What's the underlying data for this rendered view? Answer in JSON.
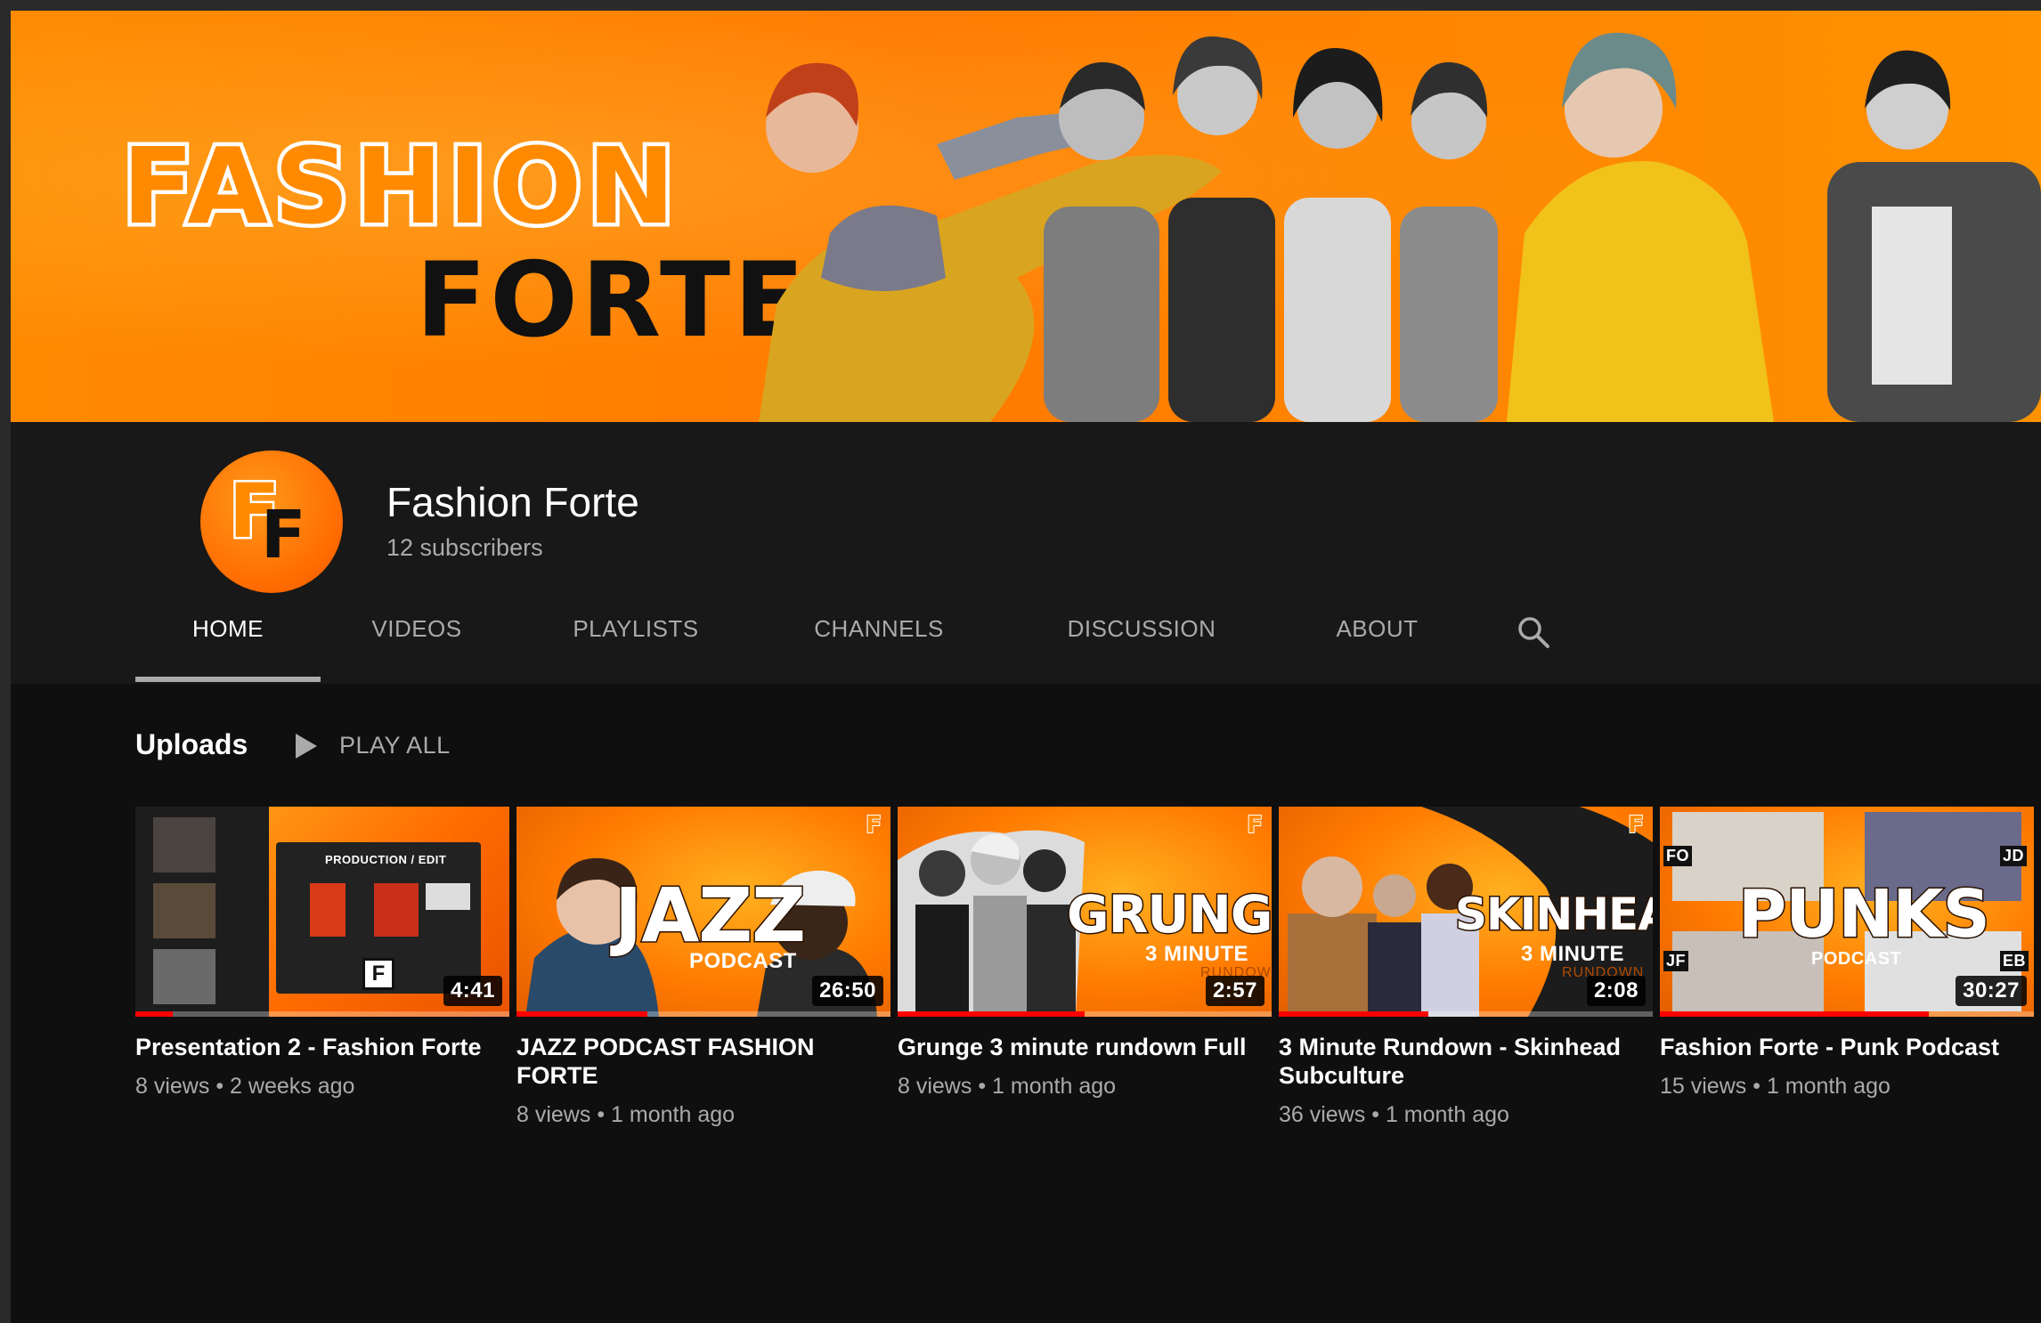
{
  "banner": {
    "line1": "FASHION",
    "line2": "FORTE",
    "background_color": "#ff8000"
  },
  "channel": {
    "avatar_initials_1": "F",
    "avatar_initials_2": "F",
    "name": "Fashion Forte",
    "subscribers": "12 subscribers"
  },
  "tabs": [
    {
      "label": "HOME",
      "active": true
    },
    {
      "label": "VIDEOS",
      "active": false
    },
    {
      "label": "PLAYLISTS",
      "active": false
    },
    {
      "label": "CHANNELS",
      "active": false
    },
    {
      "label": "DISCUSSION",
      "active": false
    },
    {
      "label": "ABOUT",
      "active": false
    }
  ],
  "search_icon": "search-icon",
  "uploads": {
    "title": "Uploads",
    "play_all_label": "PLAY ALL",
    "play_icon": "play-icon"
  },
  "videos": [
    {
      "title": "Presentation 2 - Fashion Forte",
      "views": "8 views",
      "age": "2 weeks ago",
      "duration": "4:41",
      "watched_fraction": 0.1,
      "thumb_text": "PRODUCTION / EDIT",
      "thumb_badge": "F"
    },
    {
      "title": "JAZZ PODCAST FASHION FORTE",
      "views": "8 views",
      "age": "1 month ago",
      "duration": "26:50",
      "watched_fraction": 0.35,
      "thumb_text": "JAZZ",
      "thumb_sub": "PODCAST"
    },
    {
      "title": "Grunge 3 minute rundown Full",
      "views": "8 views",
      "age": "1 month ago",
      "duration": "2:57",
      "watched_fraction": 0.5,
      "thumb_text": "GRUNGE",
      "thumb_sub": "3 MINUTE",
      "thumb_sub2": "RUNDOWN"
    },
    {
      "title": "3 Minute Rundown - Skinhead Subculture",
      "views": "36 views",
      "age": "1 month ago",
      "duration": "2:08",
      "watched_fraction": 0.4,
      "thumb_text": "SKINHEADS",
      "thumb_sub": "3 MINUTE",
      "thumb_sub2": "RUNDOWN"
    },
    {
      "title": "Fashion Forte - Punk Podcast",
      "views": "15 views",
      "age": "1 month ago",
      "duration": "30:27",
      "watched_fraction": 0.72,
      "thumb_text": "PUNKS",
      "thumb_sub": "PODCAST",
      "thumb_tags": [
        "FO",
        "JD",
        "JF",
        "EB"
      ]
    }
  ],
  "meta_separator": "•"
}
